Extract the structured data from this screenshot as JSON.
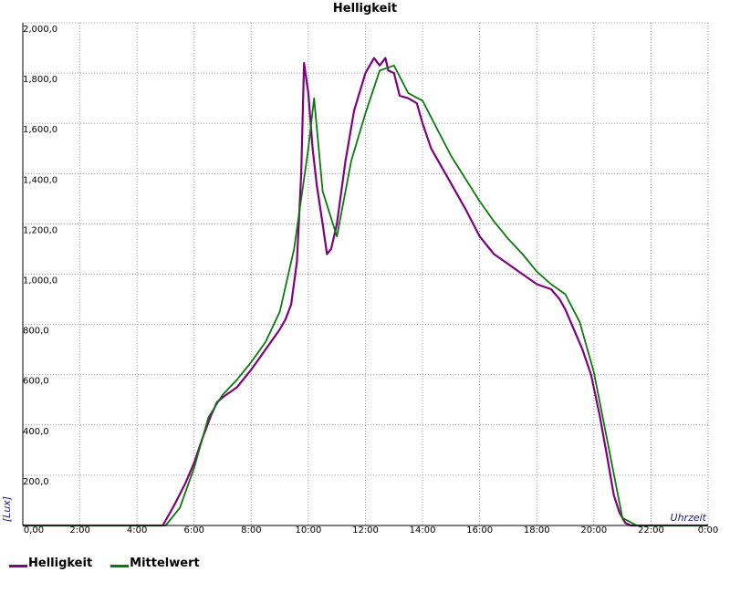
{
  "chart_data": {
    "type": "line",
    "title": "Helligkeit",
    "xlabel": "Uhrzeit",
    "ylabel": "[Lux]",
    "xlim": [
      0,
      24
    ],
    "ylim": [
      0,
      2000
    ],
    "grid": true,
    "legend_position": "bottom-left",
    "x_ticks": [
      "0,00",
      "2:00",
      "4:00",
      "6:00",
      "8:00",
      "10:00",
      "12:00",
      "14:00",
      "16:00",
      "18:00",
      "20:00",
      "22:00",
      "0:00"
    ],
    "y_ticks": [
      "200,0",
      "400,0",
      "600,0",
      "800,0",
      "1,000,0",
      "1,200,0",
      "1,400,0",
      "1,600,0",
      "1,800,0",
      "2,000,0"
    ],
    "series": [
      {
        "name": "Helligkeit",
        "color": "#800080",
        "x": [
          0,
          4.9,
          5.0,
          5.3,
          5.7,
          6.0,
          6.3,
          6.6,
          6.8,
          7.0,
          7.5,
          8.0,
          8.5,
          9.0,
          9.2,
          9.4,
          9.6,
          9.75,
          9.85,
          10.0,
          10.15,
          10.3,
          10.5,
          10.65,
          10.8,
          11.0,
          11.3,
          11.6,
          12.0,
          12.3,
          12.5,
          12.7,
          12.8,
          13.0,
          13.2,
          13.5,
          13.8,
          14.0,
          14.3,
          14.6,
          15.0,
          15.5,
          16.0,
          16.5,
          17.0,
          17.5,
          18.0,
          18.5,
          18.8,
          19.0,
          19.3,
          19.6,
          19.9,
          20.2,
          20.5,
          20.7,
          20.9,
          21.1,
          21.3,
          21.5,
          24
        ],
        "y": [
          0,
          0,
          20,
          80,
          170,
          250,
          350,
          440,
          490,
          510,
          550,
          620,
          700,
          780,
          820,
          880,
          1050,
          1400,
          1840,
          1720,
          1500,
          1350,
          1200,
          1080,
          1100,
          1200,
          1450,
          1650,
          1800,
          1860,
          1830,
          1860,
          1810,
          1800,
          1710,
          1700,
          1680,
          1600,
          1500,
          1440,
          1360,
          1260,
          1150,
          1080,
          1040,
          1000,
          960,
          940,
          900,
          860,
          780,
          700,
          600,
          440,
          250,
          120,
          50,
          10,
          0,
          0,
          0
        ]
      },
      {
        "name": "Mittelwert",
        "color": "#0a7a0a",
        "x": [
          0,
          5.0,
          5.5,
          6.0,
          6.5,
          7.0,
          7.5,
          8.0,
          8.5,
          9.0,
          9.5,
          10.0,
          10.2,
          10.5,
          11.0,
          11.5,
          12.0,
          12.5,
          13.0,
          13.5,
          14.0,
          14.5,
          15.0,
          15.5,
          16.0,
          16.5,
          17.0,
          17.5,
          18.0,
          18.5,
          19.0,
          19.5,
          20.0,
          20.5,
          21.0,
          21.5,
          22.0,
          24
        ],
        "y": [
          0,
          0,
          70,
          230,
          430,
          520,
          580,
          650,
          730,
          850,
          1100,
          1500,
          1700,
          1330,
          1150,
          1450,
          1640,
          1810,
          1830,
          1720,
          1690,
          1580,
          1470,
          1380,
          1290,
          1210,
          1140,
          1080,
          1010,
          960,
          920,
          810,
          610,
          320,
          30,
          0,
          0,
          0
        ]
      }
    ]
  }
}
